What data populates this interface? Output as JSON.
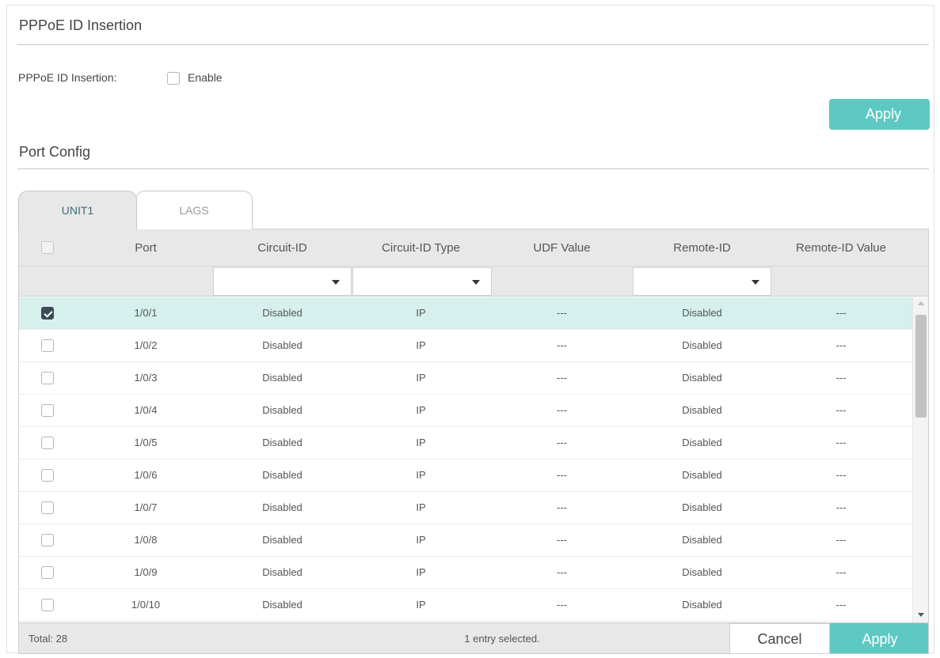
{
  "pppoe_section": {
    "title": "PPPoE ID Insertion",
    "field_label": "PPPoE ID Insertion:",
    "enable_label": "Enable",
    "enable_checked": false,
    "apply_label": "Apply"
  },
  "port_section": {
    "title": "Port Config"
  },
  "tabs": [
    {
      "label": "UNIT1",
      "active": true
    },
    {
      "label": "LAGS",
      "active": false
    }
  ],
  "table": {
    "columns": [
      "Port",
      "Circuit-ID",
      "Circuit-ID Type",
      "UDF Value",
      "Remote-ID",
      "Remote-ID Value"
    ],
    "rows": [
      {
        "port": "1/0/1",
        "circuit_id": "Disabled",
        "circuit_id_type": "IP",
        "udf_value": "---",
        "remote_id": "Disabled",
        "remote_id_value": "---",
        "checked": true
      },
      {
        "port": "1/0/2",
        "circuit_id": "Disabled",
        "circuit_id_type": "IP",
        "udf_value": "---",
        "remote_id": "Disabled",
        "remote_id_value": "---",
        "checked": false
      },
      {
        "port": "1/0/3",
        "circuit_id": "Disabled",
        "circuit_id_type": "IP",
        "udf_value": "---",
        "remote_id": "Disabled",
        "remote_id_value": "---",
        "checked": false
      },
      {
        "port": "1/0/4",
        "circuit_id": "Disabled",
        "circuit_id_type": "IP",
        "udf_value": "---",
        "remote_id": "Disabled",
        "remote_id_value": "---",
        "checked": false
      },
      {
        "port": "1/0/5",
        "circuit_id": "Disabled",
        "circuit_id_type": "IP",
        "udf_value": "---",
        "remote_id": "Disabled",
        "remote_id_value": "---",
        "checked": false
      },
      {
        "port": "1/0/6",
        "circuit_id": "Disabled",
        "circuit_id_type": "IP",
        "udf_value": "---",
        "remote_id": "Disabled",
        "remote_id_value": "---",
        "checked": false
      },
      {
        "port": "1/0/7",
        "circuit_id": "Disabled",
        "circuit_id_type": "IP",
        "udf_value": "---",
        "remote_id": "Disabled",
        "remote_id_value": "---",
        "checked": false
      },
      {
        "port": "1/0/8",
        "circuit_id": "Disabled",
        "circuit_id_type": "IP",
        "udf_value": "---",
        "remote_id": "Disabled",
        "remote_id_value": "---",
        "checked": false
      },
      {
        "port": "1/0/9",
        "circuit_id": "Disabled",
        "circuit_id_type": "IP",
        "udf_value": "---",
        "remote_id": "Disabled",
        "remote_id_value": "---",
        "checked": false
      },
      {
        "port": "1/0/10",
        "circuit_id": "Disabled",
        "circuit_id_type": "IP",
        "udf_value": "---",
        "remote_id": "Disabled",
        "remote_id_value": "---",
        "checked": false
      }
    ]
  },
  "footer": {
    "total": "Total: 28",
    "selection": "1 entry selected.",
    "cancel_label": "Cancel",
    "apply_label": "Apply"
  },
  "colors": {
    "accent": "#5ec8c2",
    "selected_row": "#d5f0ed",
    "header_bg": "#e8e8e8"
  },
  "icons": {
    "dropdown": "caret-down-icon",
    "checkbox": "checkbox-icon",
    "scroll_up": "scroll-up-arrow-icon",
    "scroll_down": "scroll-down-arrow-icon"
  }
}
